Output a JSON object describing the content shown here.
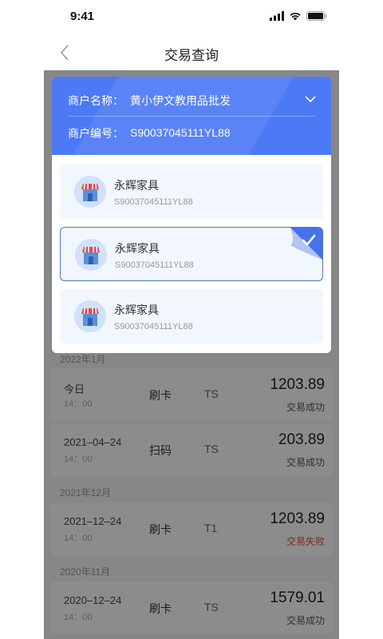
{
  "status_bar": {
    "time": "9:41"
  },
  "nav": {
    "title": "交易查询"
  },
  "merchant_selector": {
    "name_label": "商户名称：",
    "name_value": "黄小伊文教用品批发",
    "code_label": "商户编号：",
    "code_value": "S90037045111YL88",
    "header_color": "#4c79f6"
  },
  "merchant_options": [
    {
      "name": "永辉家具",
      "code": "S90037045111YL88",
      "selected": false
    },
    {
      "name": "永辉家具",
      "code": "S90037045111YL88",
      "selected": true
    },
    {
      "name": "永辉家具",
      "code": "S90037045111YL88",
      "selected": false
    }
  ],
  "transactions": {
    "month_1": "2022年1月",
    "month_2": "2021年12月",
    "month_3": "2020年11月",
    "items": [
      {
        "date": "今日",
        "time": "14：00",
        "type": "刷卡",
        "code": "TS",
        "amount": "1203.89",
        "status": "交易成功"
      },
      {
        "date": "2021–04–24",
        "time": "14：00",
        "type": "扫码",
        "code": "TS",
        "amount": "203.89",
        "status": "交易成功"
      },
      {
        "date": "2021–12–24",
        "time": "14：00",
        "type": "刷卡",
        "code": "T1",
        "amount": "1203.89",
        "status": "交易失败"
      },
      {
        "date": "2020–12–24",
        "time": "14：00",
        "type": "刷卡",
        "code": "TS",
        "amount": "1579.01",
        "status": "交易成功"
      }
    ]
  },
  "colors": {
    "fail": "#e0503a",
    "selected_border": "#5477b8"
  }
}
